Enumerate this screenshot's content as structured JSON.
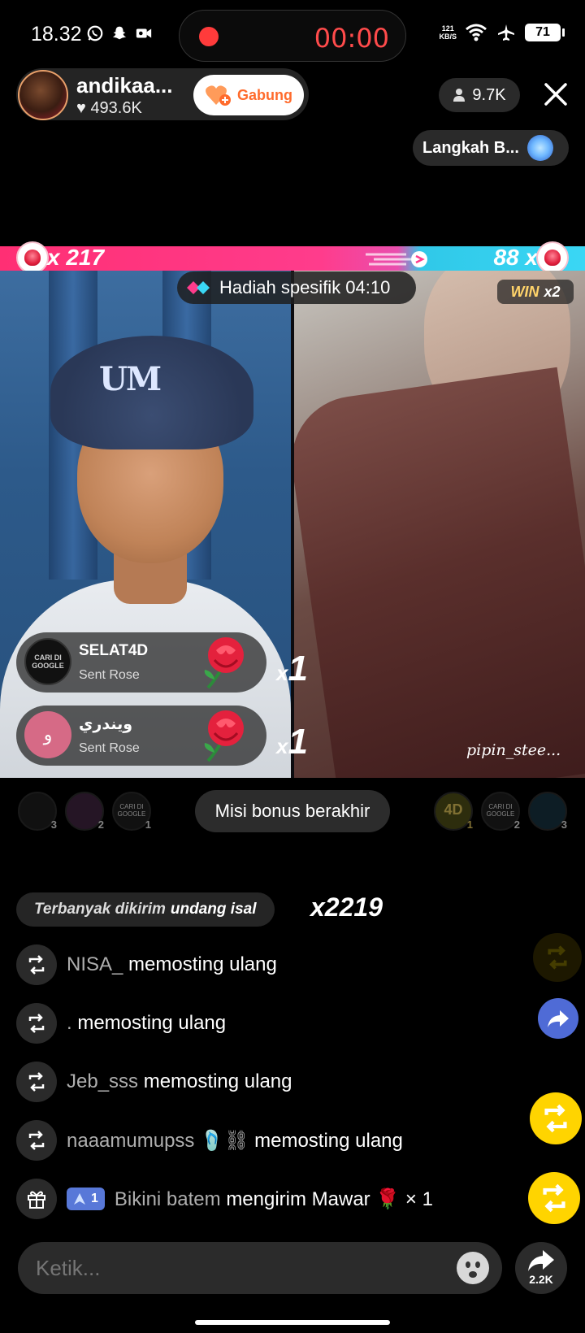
{
  "status_bar": {
    "time": "18.32",
    "record_time": "00:00",
    "net_speed_value": "121",
    "net_speed_unit": "KB/S",
    "battery": "71"
  },
  "host": {
    "name": "andikaa...",
    "likes": "493.6K",
    "join_label": "Gabung",
    "viewers": "9.7K",
    "step_label": "Langkah B..."
  },
  "battle": {
    "left_score": "217",
    "right_score": "88",
    "timer_label": "Hadiah spesifik 04:10",
    "win_label": "WIN",
    "win_mult": "x2"
  },
  "gifts": [
    {
      "name": "SELAT4D",
      "sub": "Sent Rose",
      "avatar_text": "CARI DI GOOGLE",
      "count": "1"
    },
    {
      "name": "ويندري",
      "sub": "Sent Rose",
      "avatar_text": "و",
      "count": "1"
    }
  ],
  "right_streamer": "pipin_stee...",
  "contributors": {
    "left_ranks": [
      "3",
      "2",
      "1"
    ],
    "right_ranks": [
      "1",
      "2",
      "3"
    ],
    "left_third_text": "CARI DI GOOGLE",
    "right_first_text": "4D",
    "right_second_text": "CARI DI GOOGLE"
  },
  "misi_label": "Misi bonus berakhir",
  "top_sent": {
    "prefix": "Terbanyak dikirim",
    "user": "undang isal",
    "count": "x2219"
  },
  "chat": [
    {
      "icon": "repost-icon",
      "user": "NISA_",
      "msg": "memosting ulang"
    },
    {
      "icon": "repost-icon",
      "user": ".",
      "msg": "memosting ulang"
    },
    {
      "icon": "repost-icon",
      "user": "Jeb_sss",
      "msg": "memosting ulang"
    },
    {
      "icon": "repost-icon",
      "user": "naaamumupss 🩴⛓",
      "msg": "memosting ulang"
    },
    {
      "icon": "gift-icon",
      "rank": "1",
      "user": "Bikini batem",
      "msg": "mengirim Mawar 🌹 × 1"
    }
  ],
  "input": {
    "placeholder": "Ketik..."
  },
  "share_count": "2.2K",
  "colors": {
    "left_team": "#ff2f74",
    "right_team": "#3ad7f5",
    "accent_yellow": "#ffd400",
    "record_red": "#ff4b4b"
  }
}
